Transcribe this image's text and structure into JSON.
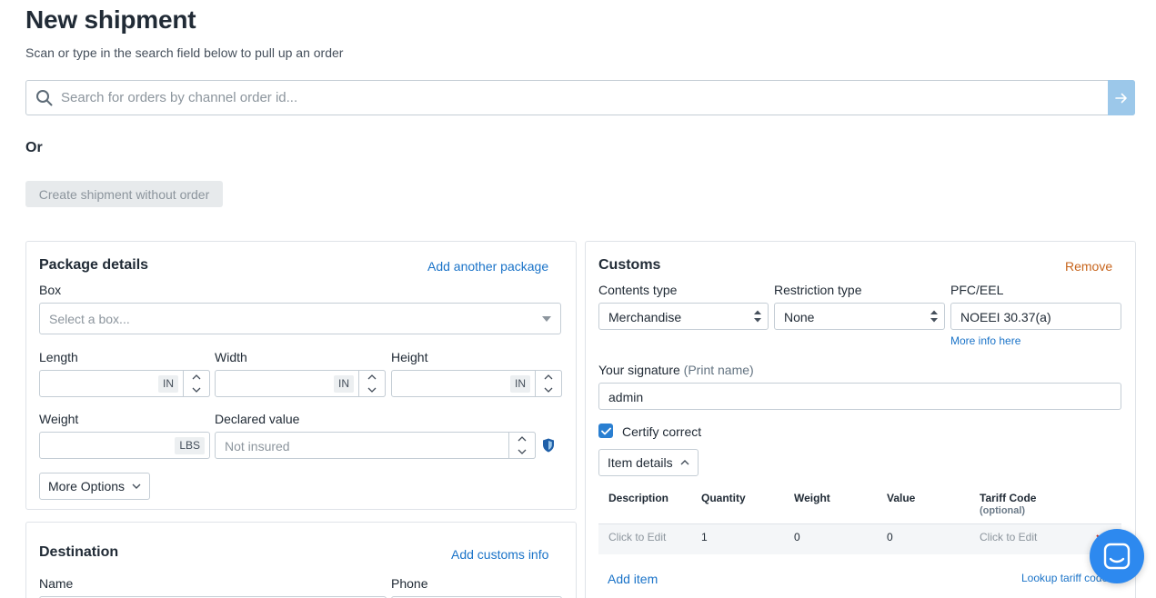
{
  "page": {
    "title": "New shipment",
    "subtitle": "Scan or type in the search field below to pull up an order"
  },
  "search": {
    "placeholder": "Search for orders by channel order id..."
  },
  "or_label": "Or",
  "create_without_order_label": "Create shipment without order",
  "package": {
    "title": "Package details",
    "add_package_link": "Add another package",
    "box_label": "Box",
    "box_placeholder": "Select a box...",
    "length_label": "Length",
    "width_label": "Width",
    "height_label": "Height",
    "dim_unit": "IN",
    "weight_label": "Weight",
    "weight_unit": "LBS",
    "declared_label": "Declared value",
    "declared_placeholder": "Not insured",
    "more_options_label": "More Options"
  },
  "destination": {
    "title": "Destination",
    "add_customs_link": "Add customs info",
    "name_label": "Name",
    "phone_label": "Phone"
  },
  "customs": {
    "title": "Customs",
    "remove_link": "Remove",
    "contents_type_label": "Contents type",
    "contents_type_value": "Merchandise",
    "restriction_type_label": "Restriction type",
    "restriction_type_value": "None",
    "pfc_label": "PFC/EEL",
    "pfc_value": "NOEEI 30.37(a)",
    "more_info_link": "More info here",
    "signature_label": "Your signature",
    "signature_hint": "(Print name)",
    "signature_value": "admin",
    "certify_label": "Certify correct",
    "certify_checked": true,
    "item_details_label": "Item details",
    "table": {
      "headers": {
        "description": "Description",
        "quantity": "Quantity",
        "weight": "Weight",
        "value": "Value",
        "tariff": "Tariff Code",
        "tariff_optional": "(optional)"
      },
      "rows": [
        {
          "description": "Click to Edit",
          "quantity": "1",
          "weight": "0",
          "value": "0",
          "tariff": "Click to Edit"
        }
      ]
    },
    "add_item_link": "Add item",
    "lookup_tariff_link": "Lookup tariff code"
  },
  "colors": {
    "link": "#1a73c8",
    "remove": "#c7641c",
    "search_button": "#9cc8ea",
    "checkbox": "#2a7fd1",
    "chat_button": "#2d89ef"
  }
}
